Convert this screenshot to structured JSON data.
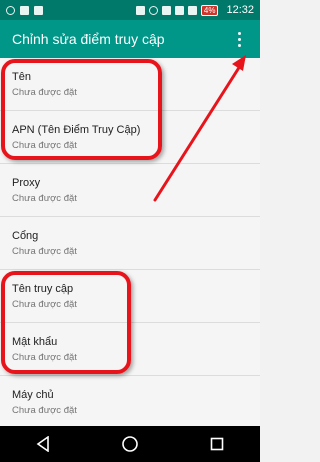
{
  "status_bar": {
    "battery_label": "4%",
    "time": "12:32"
  },
  "app_bar": {
    "title": "Chỉnh sửa điểm truy cập",
    "overflow_icon": "more-vert-icon"
  },
  "settings_items": [
    {
      "title": "Tên",
      "subtitle": "Chưa được đặt"
    },
    {
      "title": "APN (Tên Điểm Truy Cập)",
      "subtitle": "Chưa được đặt"
    },
    {
      "title": "Proxy",
      "subtitle": "Chưa được đặt"
    },
    {
      "title": "Cổng",
      "subtitle": "Chưa được đặt"
    },
    {
      "title": "Tên truy cập",
      "subtitle": "Chưa được đặt"
    },
    {
      "title": "Mật khẩu",
      "subtitle": "Chưa được đặt"
    },
    {
      "title": "Máy chủ",
      "subtitle": "Chưa được đặt"
    }
  ],
  "nav_bar": {
    "back_icon": "back-icon",
    "home_icon": "home-icon",
    "recents_icon": "recents-icon"
  },
  "colors": {
    "status_bar": "#00796b",
    "app_bar": "#009688",
    "annotation": "#e8141c"
  }
}
